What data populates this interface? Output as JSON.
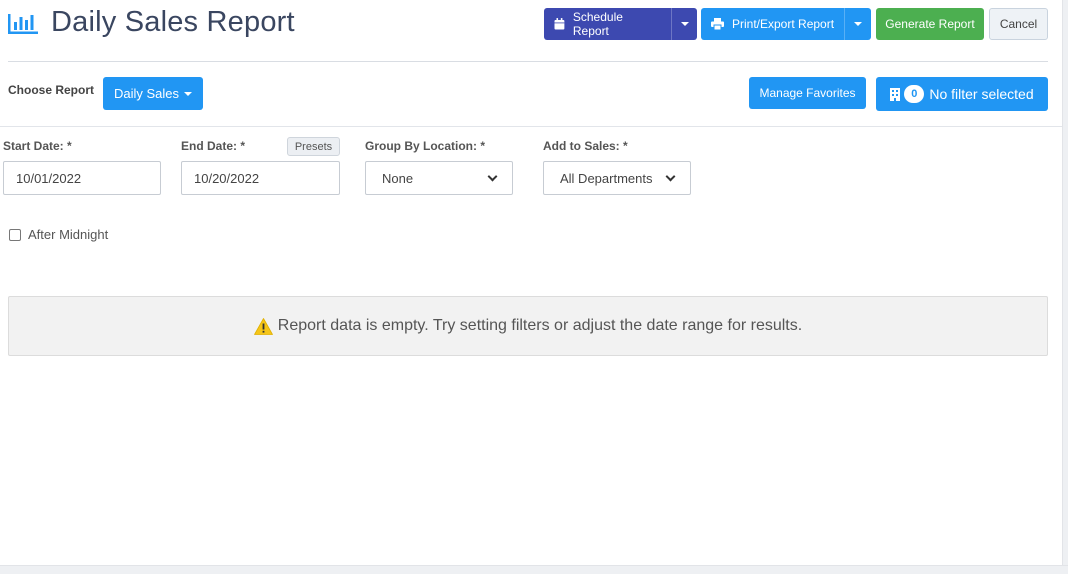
{
  "header": {
    "title": "Daily Sales Report",
    "schedule_label": "Schedule Report",
    "print_label": "Print/Export Report",
    "generate_label": "Generate Report",
    "cancel_label": "Cancel"
  },
  "report_chooser": {
    "label": "Choose Report",
    "selected": "Daily Sales",
    "manage_favorites_label": "Manage Favorites",
    "filter_count": "0",
    "filter_label": "No filter selected"
  },
  "filters": {
    "start_date": {
      "label": "Start Date: *",
      "value": "10/01/2022"
    },
    "end_date": {
      "label": "End Date: *",
      "value": "10/20/2022"
    },
    "presets_label": "Presets",
    "group_by_location": {
      "label": "Group By Location: *",
      "value": "None"
    },
    "add_to_sales": {
      "label": "Add to Sales: *",
      "value": "All Departments"
    },
    "after_midnight": {
      "label": "After Midnight",
      "checked": false
    }
  },
  "alert": {
    "message": "Report data is empty. Try setting filters or adjust the date range for results."
  },
  "colors": {
    "schedule": "#3d49b0",
    "primary": "#2196f3",
    "success": "#4caf50",
    "warning": "#f5c518",
    "title": "#3a4660"
  },
  "icons": {
    "title": "bar-chart-icon",
    "schedule": "calendar-icon",
    "print": "printer-icon",
    "filter": "building-icon",
    "alert": "warning-triangle-icon"
  }
}
